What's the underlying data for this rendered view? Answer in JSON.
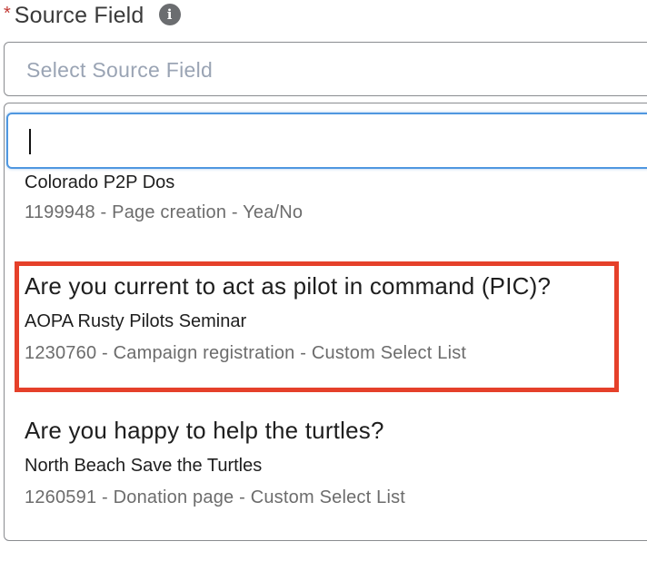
{
  "field": {
    "required_mark": "*",
    "label": "Source Field",
    "info_icon": "info-icon"
  },
  "select": {
    "placeholder": "Select Source Field"
  },
  "search": {
    "value": ""
  },
  "options": [
    {
      "campaign": "Colorado P2P Dos",
      "meta": "1199948 - Page creation - Yea/No"
    },
    {
      "title": "Are you current to act as pilot in command (PIC)?",
      "campaign": "AOPA Rusty Pilots Seminar",
      "meta": "1230760 - Campaign registration - Custom Select List",
      "highlighted": true
    },
    {
      "title": "Are you happy to help the turtles?",
      "campaign": "North Beach Save the Turtles",
      "meta": "1260591 - Donation page - Custom Select List"
    }
  ],
  "colors": {
    "highlight": "#e5402a",
    "focus": "#4f97e0",
    "placeholder": "#9aa4b4",
    "required": "#c23934"
  }
}
